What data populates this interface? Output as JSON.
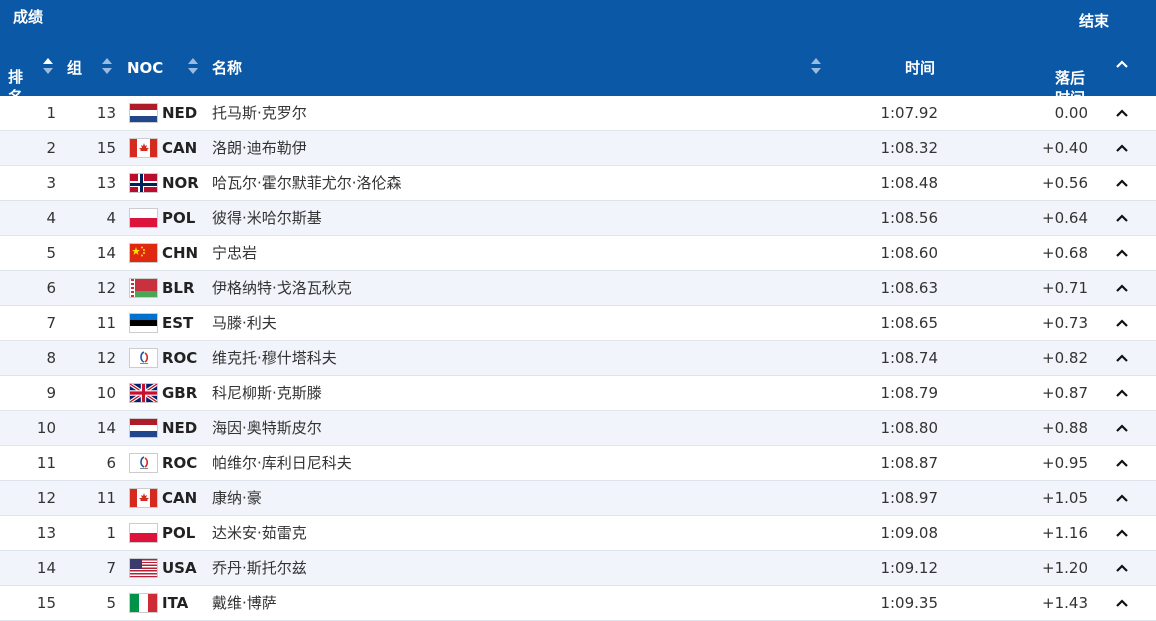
{
  "header": {
    "title": "成绩",
    "status": "结束",
    "columns": {
      "rank": "排\n名",
      "group": "组",
      "noc": "NOC",
      "name": "名称",
      "time": "时间",
      "gap": "落后\n时间"
    }
  },
  "rows": [
    {
      "rank": "1",
      "group": "13",
      "noc": "NED",
      "name": "托马斯·克罗尔",
      "time": "1:07.92",
      "gap": "0.00"
    },
    {
      "rank": "2",
      "group": "15",
      "noc": "CAN",
      "name": "洛朗·迪布勒伊",
      "time": "1:08.32",
      "gap": "+0.40"
    },
    {
      "rank": "3",
      "group": "13",
      "noc": "NOR",
      "name": "哈瓦尔·霍尔默菲尤尔·洛伦森",
      "time": "1:08.48",
      "gap": "+0.56"
    },
    {
      "rank": "4",
      "group": "4",
      "noc": "POL",
      "name": "彼得·米哈尔斯基",
      "time": "1:08.56",
      "gap": "+0.64"
    },
    {
      "rank": "5",
      "group": "14",
      "noc": "CHN",
      "name": "宁忠岩",
      "time": "1:08.60",
      "gap": "+0.68"
    },
    {
      "rank": "6",
      "group": "12",
      "noc": "BLR",
      "name": "伊格纳特·戈洛瓦秋克",
      "time": "1:08.63",
      "gap": "+0.71"
    },
    {
      "rank": "7",
      "group": "11",
      "noc": "EST",
      "name": "马滕·利夫",
      "time": "1:08.65",
      "gap": "+0.73"
    },
    {
      "rank": "8",
      "group": "12",
      "noc": "ROC",
      "name": "维克托·穆什塔科夫",
      "time": "1:08.74",
      "gap": "+0.82"
    },
    {
      "rank": "9",
      "group": "10",
      "noc": "GBR",
      "name": "科尼柳斯·克斯滕",
      "time": "1:08.79",
      "gap": "+0.87"
    },
    {
      "rank": "10",
      "group": "14",
      "noc": "NED",
      "name": "海因·奥特斯皮尔",
      "time": "1:08.80",
      "gap": "+0.88"
    },
    {
      "rank": "11",
      "group": "6",
      "noc": "ROC",
      "name": "帕维尔·库利日尼科夫",
      "time": "1:08.87",
      "gap": "+0.95"
    },
    {
      "rank": "12",
      "group": "11",
      "noc": "CAN",
      "name": "康纳·豪",
      "time": "1:08.97",
      "gap": "+1.05"
    },
    {
      "rank": "13",
      "group": "1",
      "noc": "POL",
      "name": "达米安·茹雷克",
      "time": "1:09.08",
      "gap": "+1.16"
    },
    {
      "rank": "14",
      "group": "7",
      "noc": "USA",
      "name": "乔丹·斯托尔兹",
      "time": "1:09.12",
      "gap": "+1.20"
    },
    {
      "rank": "15",
      "group": "5",
      "noc": "ITA",
      "name": "戴维·博萨",
      "time": "1:09.35",
      "gap": "+1.43"
    }
  ],
  "icons": {
    "flag": "flag-icon",
    "chevron": "chevron-up-icon",
    "sort": "sort-icon"
  },
  "colors": {
    "header_bg": "#0a58a6",
    "alt_row": "#f1f5fb"
  }
}
